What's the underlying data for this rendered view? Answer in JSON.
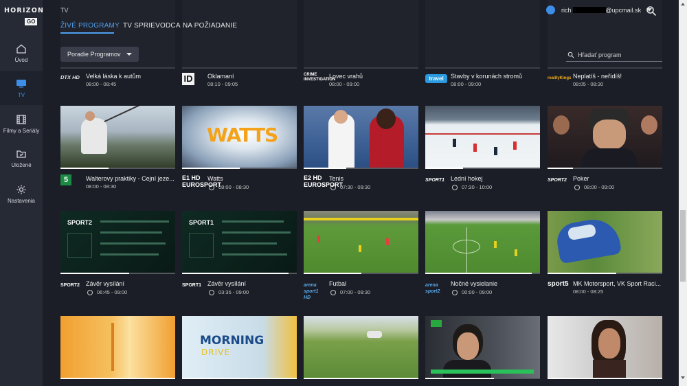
{
  "brand": {
    "line1": "HORIZON",
    "line2": "GO"
  },
  "sidebar": {
    "items": [
      {
        "label": "Úvod",
        "icon": "home-icon"
      },
      {
        "label": "TV",
        "icon": "tv-icon",
        "active": true
      },
      {
        "label": "Filmy a Seriály",
        "icon": "film-icon"
      },
      {
        "label": "Uložené",
        "icon": "saved-icon"
      },
      {
        "label": "Nastavenia",
        "icon": "gear-icon"
      }
    ]
  },
  "header": {
    "breadcrumb": "TV",
    "tabs": [
      {
        "label": "ŽIVÉ PROGRAMY",
        "active": true
      },
      {
        "label": "TV SPRIEVODCA"
      },
      {
        "label": "NA POŽIADANIE"
      }
    ],
    "user": {
      "prefix": "rich",
      "suffix": "@upcmail.sk"
    }
  },
  "toolbar": {
    "sort_label": "Poradie Programov",
    "search_placeholder": "Hľadať program"
  },
  "colors": {
    "accent": "#4f9ff0",
    "sidebar": "#262a35",
    "background": "#1b1e27"
  },
  "rows": [
    [
      {
        "channel": "DTX HD",
        "title": "Velká láska k autům",
        "time": "08:00 - 08:45",
        "clock": false
      },
      {
        "channel": "ID",
        "title": "Oklamaní",
        "time": "08:10 - 09:05",
        "clock": false
      },
      {
        "channel": "CRIME INVESTIGATION",
        "title": "Lovec vrahů",
        "time": "08:00 - 09:00",
        "clock": false
      },
      {
        "channel": "travel",
        "title": "Stavby v korunách stromů",
        "time": "08:00 - 09:00",
        "clock": false
      },
      {
        "channel": "realityKings",
        "title": "Neplatíš - neřídíš!",
        "time": "08:05 - 08:30",
        "clock": false
      }
    ],
    [
      {
        "channel": "5",
        "title": "Walterovy praktiky - Cejní jeze...",
        "time": "08:00 - 08:30",
        "clock": false,
        "progress": 0.42
      },
      {
        "channel": "E1 HD EUROSPORT",
        "title": "Watts",
        "time": "08:00 - 08:30",
        "clock": true,
        "progress": 0.5
      },
      {
        "channel": "E2 HD EUROSPORT",
        "title": "Tenis",
        "time": "07:30 - 09:30",
        "clock": true,
        "progress": 0.37
      },
      {
        "channel": "SPORT1",
        "title": "Lední hokej",
        "time": "07:30 - 10:00",
        "clock": true,
        "progress": 0.33
      },
      {
        "channel": "SPORT2",
        "title": "Poker",
        "time": "08:00 - 09:00",
        "clock": true,
        "progress": 0.22
      }
    ],
    [
      {
        "channel": "SPORT2",
        "title": "Závěr vysílání",
        "time": "06:45 - 09:00",
        "clock": true,
        "progress": 0.6
      },
      {
        "channel": "SPORT1",
        "title": "Závěr vysílání",
        "time": "03:35 - 09:00",
        "clock": true,
        "progress": 0.93
      },
      {
        "channel": "arena sport1 HD",
        "title": "Futbal",
        "time": "07:00 - 09:30",
        "clock": true,
        "progress": 0.5
      },
      {
        "channel": "arena sport2",
        "title": "Nočné vysielanie",
        "time": "00:00 - 09:00",
        "clock": true,
        "progress": 0.93
      },
      {
        "channel": "sport5",
        "title": "MK Motorsport, VK Sport Raci...",
        "time": "08:00 - 08:25",
        "clock": false,
        "progress": 0.6
      }
    ],
    [
      {
        "progress": 1.0
      },
      {
        "progress": 1.0
      },
      {
        "progress": 1.0
      },
      {
        "progress": 0.6
      },
      {
        "progress": 1.0
      }
    ]
  ]
}
